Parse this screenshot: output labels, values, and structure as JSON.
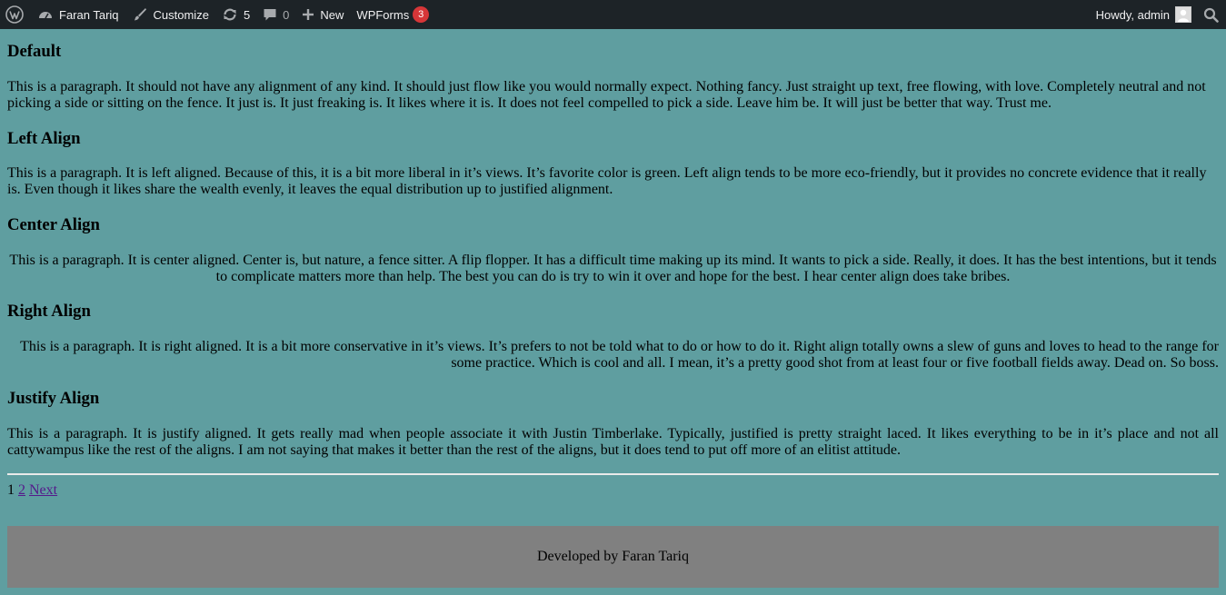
{
  "adminbar": {
    "site_name": "Faran Tariq",
    "customize": "Customize",
    "updates_count": "5",
    "comments_count": "0",
    "new_label": "New",
    "wpforms_label": "WPForms",
    "wpforms_badge": "3",
    "howdy": "Howdy, admin",
    "icons": [
      "wordpress-logo-icon",
      "dashboard-icon",
      "brush-icon",
      "updates-icon",
      "comment-icon",
      "plus-icon",
      "avatar",
      "search-icon"
    ]
  },
  "sections": [
    {
      "title": "Default",
      "text": "This is a paragraph. It should not have any alignment of any kind. It should just flow like you would normally expect. Nothing fancy. Just straight up text, free flowing, with love. Completely neutral and not picking a side or sitting on the fence. It just is. It just freaking is. It likes where it is. It does not feel compelled to pick a side. Leave him be. It will just be better that way. Trust me."
    },
    {
      "title": "Left Align",
      "text": "This is a paragraph. It is left aligned. Because of this, it is a bit more liberal in it’s views. It’s favorite color is green. Left align tends to be more eco-friendly, but it provides no concrete evidence that it really is. Even though it likes share the wealth evenly, it leaves the equal distribution up to justified alignment."
    },
    {
      "title": "Center Align",
      "text": "This is a paragraph. It is center aligned. Center is, but nature, a fence sitter. A flip flopper. It has a difficult time making up its mind. It wants to pick a side. Really, it does. It has the best intentions, but it tends to complicate matters more than help. The best you can do is try to win it over and hope for the best. I hear center align does take bribes."
    },
    {
      "title": "Right Align",
      "text": "This is a paragraph. It is right aligned. It is a bit more conservative in it’s views. It’s prefers to not be told what to do or how to do it. Right align totally owns a slew of guns and loves to head to the range for some practice. Which is cool and all. I mean, it’s a pretty good shot from at least four or five football fields away. Dead on. So boss."
    },
    {
      "title": "Justify Align",
      "text": "This is a paragraph. It is justify aligned. It gets really mad when people associate it with Justin Timberlake. Typically, justified is pretty straight laced. It likes everything to be in it’s place and not all cattywampus like the rest of the aligns. I am not saying that makes it better than the rest of the aligns, but it does tend to put off more of an elitist attitude."
    }
  ],
  "pagination": {
    "current": "1",
    "page2": "2",
    "next": "Next"
  },
  "footer": {
    "text": "Developed by Faran Tariq"
  },
  "colors": {
    "page_bg": "#5f9ea0",
    "adminbar_bg": "#1d2327",
    "badge": "#d63638",
    "footer_bg": "#808080"
  }
}
